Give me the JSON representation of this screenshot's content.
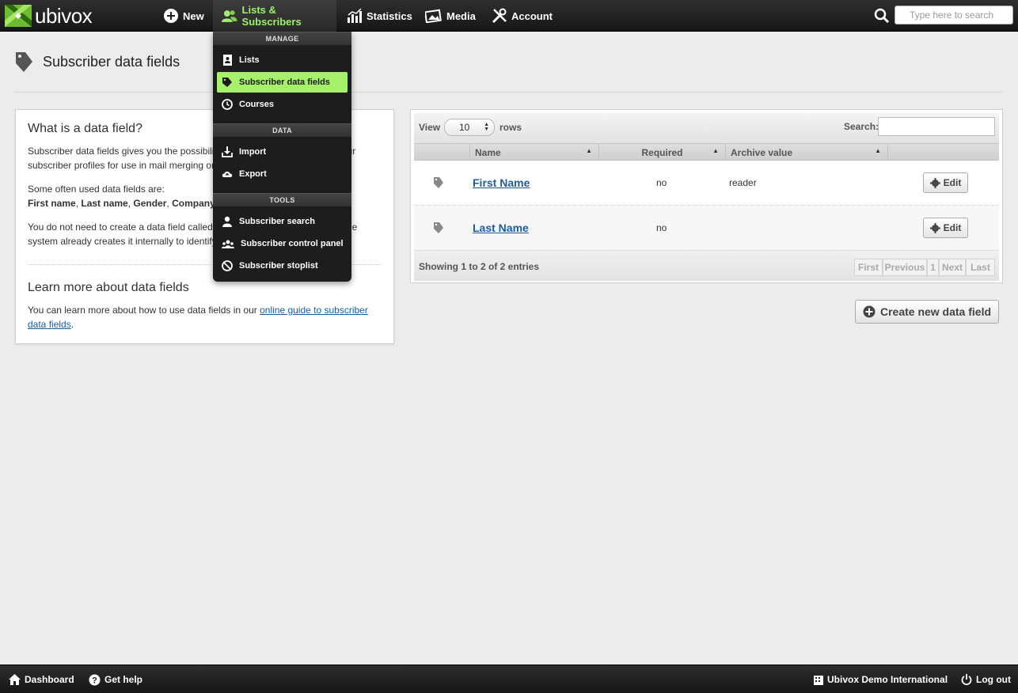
{
  "app": {
    "logo_text": "ubivox",
    "brand_color": "#9df06a"
  },
  "topnav": {
    "new_label": "New",
    "lists_label": "Lists & Subscribers",
    "statistics_label": "Statistics",
    "media_label": "Media",
    "account_label": "Account",
    "search_placeholder": "Type here to search"
  },
  "page": {
    "title": "Subscriber data fields"
  },
  "info": {
    "heading": "What is a data field?",
    "para1": "Subscriber data fields gives you the possibility to add extra information to your subscriber profiles for use in mail merging or segmentation.",
    "para2_intro": "Some often used data fields are:",
    "examples": [
      "First name",
      "Last name",
      "Gender",
      "Company"
    ],
    "para3": "You do not need to create a data field called e-mail for the e-mail address. The system already creates it internally to identify subscribers.",
    "learn_heading": "Learn more about data fields",
    "learn_text": "You can learn more about how to use data fields in our ",
    "learn_link": "online guide to subscriber data fields",
    "learn_end": "."
  },
  "table": {
    "view_label": "View",
    "rows_value": "10",
    "rows_label": "rows",
    "search_label": "Search:",
    "search_value": "",
    "columns": [
      "Name",
      "Required",
      "Archive value"
    ],
    "rows": [
      {
        "name": "First Name",
        "required": "no",
        "archive": "reader",
        "edit": "Edit"
      },
      {
        "name": "Last Name",
        "required": "no",
        "archive": "",
        "edit": "Edit"
      }
    ],
    "info": "Showing 1 to 2 of 2 entries",
    "pager": [
      "First",
      "Previous",
      "1",
      "Next",
      "Last"
    ]
  },
  "create_button": "Create new data field",
  "dropdown": {
    "sections": [
      {
        "title": "MANAGE",
        "items": [
          "Lists",
          "Subscriber data fields",
          "Courses"
        ]
      },
      {
        "title": "DATA",
        "items": [
          "Import",
          "Export"
        ]
      },
      {
        "title": "TOOLS",
        "items": [
          "Subscriber search",
          "Subscriber control panel",
          "Subscriber stoplist"
        ]
      }
    ],
    "selected": "Subscriber data fields"
  },
  "footer": {
    "dashboard": "Dashboard",
    "help": "Get help",
    "account_name": "Ubivox Demo International",
    "logout": "Log out"
  }
}
